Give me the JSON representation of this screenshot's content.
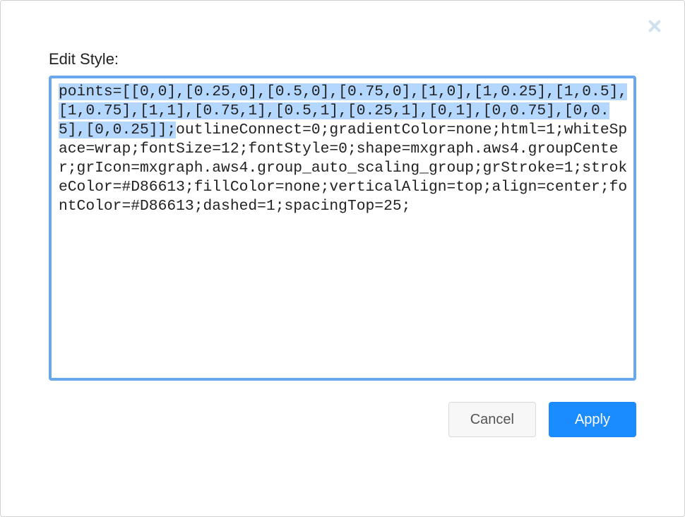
{
  "dialog": {
    "title": "Edit Style:",
    "style_selected": "points=[[0,0],[0.25,0],[0.5,0],[0.75,0],[1,0],[1,0.25],[1,0.5],[1,0.75],[1,1],[0.75,1],[0.5,1],[0.25,1],[0,1],[0,0.75],[0,0.5],[0,0.25]];",
    "style_rest": "outlineConnect=0;gradientColor=none;html=1;whiteSpace=wrap;fontSize=12;fontStyle=0;shape=mxgraph.aws4.groupCenter;grIcon=mxgraph.aws4.group_auto_scaling_group;grStroke=1;strokeColor=#D86613;fillColor=none;verticalAlign=top;align=center;fontColor=#D86613;dashed=1;spacingTop=25;"
  },
  "buttons": {
    "cancel": "Cancel",
    "apply": "Apply"
  },
  "icons": {
    "close": "close"
  },
  "colors": {
    "focus_border": "#69a8ee",
    "primary": "#1a8cff",
    "selection": "#b4d7ff"
  }
}
